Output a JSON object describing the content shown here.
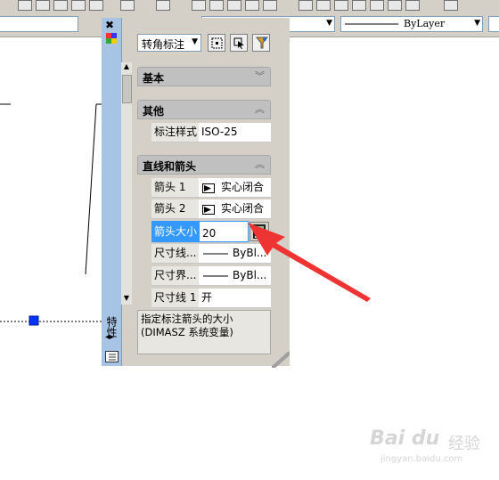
{
  "propbar": {
    "linetype_value": "ByLayer"
  },
  "palette": {
    "title": "特性",
    "object_type": "转角标注",
    "sections": [
      {
        "label": "基本"
      },
      {
        "label": "其他"
      },
      {
        "label": "直线和箭头"
      }
    ],
    "other_rows": [
      {
        "name": "标注样式",
        "value": "ISO-25"
      }
    ],
    "line_rows": [
      {
        "name": "箭头 1",
        "value": "实心闭合"
      },
      {
        "name": "箭头 2",
        "value": "实心闭合"
      },
      {
        "name": "箭头大小",
        "value": "20"
      },
      {
        "name": "尺寸线...",
        "value": "ByBl..."
      },
      {
        "name": "尺寸界...",
        "value": "ByBl..."
      },
      {
        "name": "尺寸线 1",
        "value": "开"
      }
    ],
    "description": "指定标注箭头的大小 (DIMASZ 系统变量)"
  },
  "watermark": {
    "brand": "Bai du",
    "sub": "经验",
    "url": "jingyan.baidu.com"
  },
  "colors": {
    "highlight": "#3399ff",
    "arrow": "#ee3333",
    "grip": "#0033ff"
  }
}
